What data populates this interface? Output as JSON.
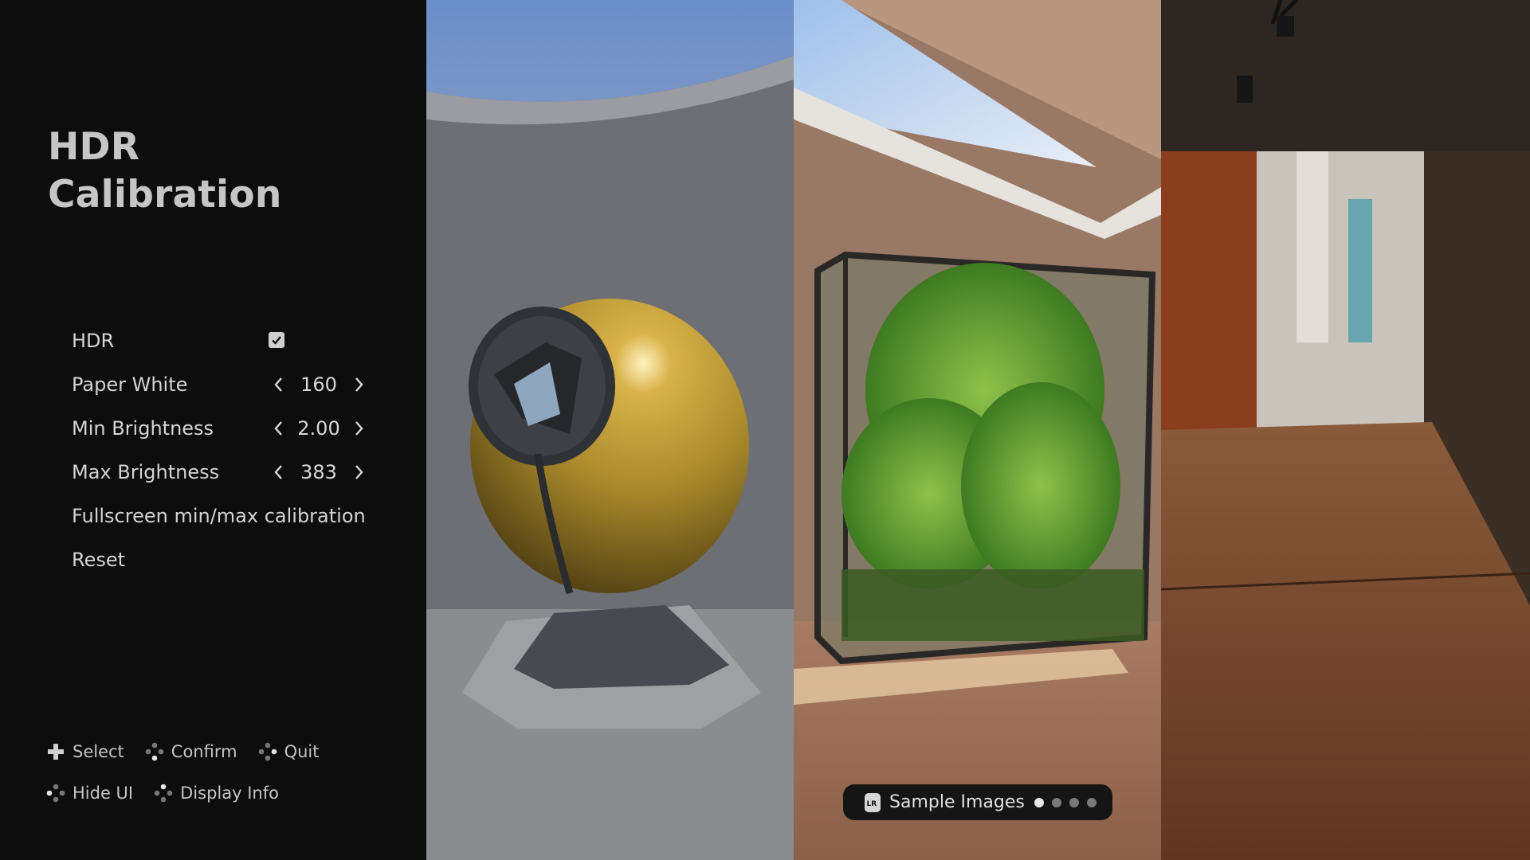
{
  "title": {
    "line1": "HDR",
    "line2": "Calibration"
  },
  "settings": {
    "hdr": {
      "label": "HDR",
      "checked": true
    },
    "paper_white": {
      "label": "Paper White",
      "value": "160"
    },
    "min_brightness": {
      "label": "Min Brightness",
      "value": "2.00"
    },
    "max_brightness": {
      "label": "Max Brightness",
      "value": "383"
    },
    "fullscreen": {
      "label": "Fullscreen min/max calibration"
    },
    "reset": {
      "label": "Reset"
    }
  },
  "hints": {
    "select": {
      "label": "Select",
      "icon": "dpad-icon"
    },
    "confirm": {
      "label": "Confirm",
      "icon": "face-button-bottom-icon"
    },
    "quit": {
      "label": "Quit",
      "icon": "face-button-right-icon"
    },
    "hide_ui": {
      "label": "Hide UI",
      "icon": "face-button-left-icon"
    },
    "display_info": {
      "label": "Display Info",
      "icon": "face-button-top-icon"
    }
  },
  "sample_images": {
    "label": "Sample Images",
    "icon": "lr-shoulder-icon",
    "page_count": 4,
    "active_index": 0
  },
  "colors": {
    "panel_bg": "#0d0d0e",
    "text": "#d4d4d4",
    "title": "#c6c6c6",
    "pill_bg": "#151515"
  }
}
